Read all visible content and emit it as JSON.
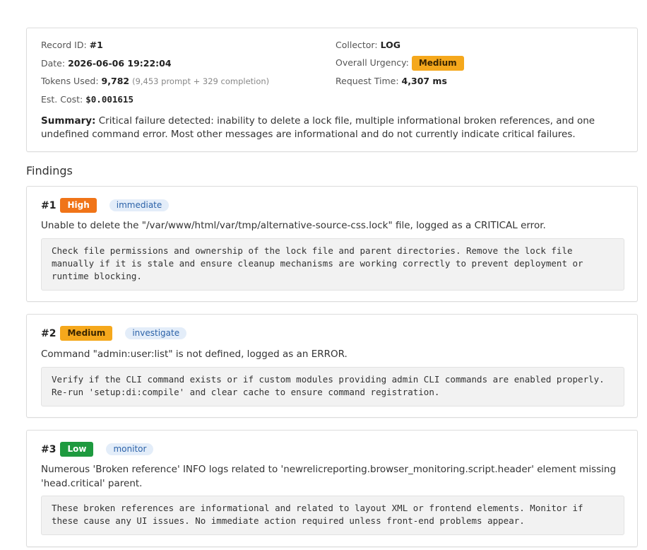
{
  "record": {
    "record_id_label": "Record ID:",
    "record_id": "#1",
    "date_label": "Date:",
    "date": "2026-06-06 19:22:04",
    "tokens_label": "Tokens Used:",
    "tokens": "9,782",
    "tokens_detail": "(9,453 prompt + 329 completion)",
    "cost_label": "Est. Cost:",
    "cost": "$0.001615",
    "collector_label": "Collector:",
    "collector": "LOG",
    "urgency_label": "Overall Urgency:",
    "urgency": "Medium",
    "request_time_label": "Request Time:",
    "request_time": "4,307 ms",
    "summary_label": "Summary:",
    "summary": "Critical failure detected: inability to delete a lock file, multiple informational broken references, and one undefined command error. Most other messages are informational and do not currently indicate critical failures."
  },
  "findings_title": "Findings",
  "findings": [
    {
      "num": "#1",
      "severity": "High",
      "action": "immediate",
      "description": "Unable to delete the \"/var/www/html/var/tmp/alternative-source-css.lock\" file, logged as a CRITICAL error.",
      "recommendation": "Check file permissions and ownership of the lock file and parent directories. Remove the lock file manually if it is stale and ensure cleanup mechanisms are working correctly to prevent deployment or runtime blocking."
    },
    {
      "num": "#2",
      "severity": "Medium",
      "action": "investigate",
      "description": "Command \"admin:user:list\" is not defined, logged as an ERROR.",
      "recommendation": "Verify if the CLI command exists or if custom modules providing admin CLI commands are enabled properly. Re-run 'setup:di:compile' and clear cache to ensure command registration."
    },
    {
      "num": "#3",
      "severity": "Low",
      "action": "monitor",
      "description": "Numerous 'Broken reference' INFO logs related to 'newrelicreporting.browser_monitoring.script.header' element missing 'head.critical' parent.",
      "recommendation": "These broken references are informational and related to layout XML or frontend elements. Monitor if these cause any UI issues. No immediate action required unless front-end problems appear."
    }
  ],
  "colors": {
    "high": "#f07418",
    "medium": "#f5a81c",
    "low": "#1e9a3f",
    "action_bg": "#e3edf9",
    "action_text": "#2c62a8"
  }
}
